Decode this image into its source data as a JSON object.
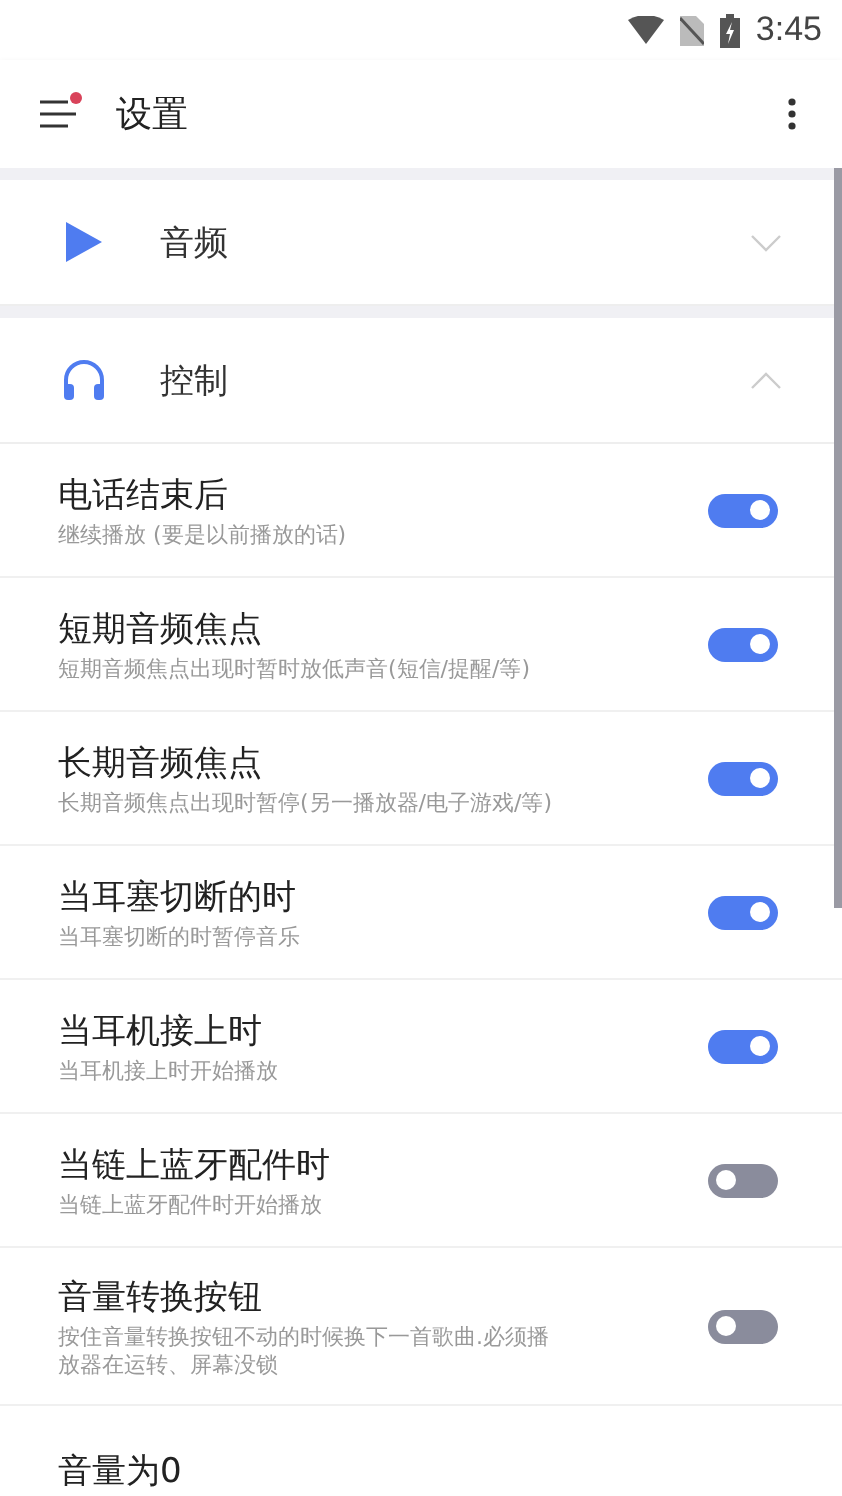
{
  "status_bar": {
    "time": "3:45"
  },
  "toolbar": {
    "title": "设置",
    "menu_badge": true
  },
  "sections": [
    {
      "kind": "play",
      "title": "音频",
      "expanded": false
    },
    {
      "kind": "headphones",
      "title": "控制",
      "expanded": true
    }
  ],
  "settings": [
    {
      "kind": "toggle",
      "title": "电话结束后",
      "subtitle": "继续播放 (要是以前播放的话)",
      "on": true
    },
    {
      "kind": "toggle",
      "title": "短期音频焦点",
      "subtitle": "短期音频焦点出现时暂时放低声音(短信/提醒/等)",
      "on": true
    },
    {
      "kind": "toggle",
      "title": "长期音频焦点",
      "subtitle": "长期音频焦点出现时暂停(另一播放器/电子游戏/等)",
      "on": true
    },
    {
      "kind": "toggle",
      "title": "当耳塞切断的时",
      "subtitle": "当耳塞切断的时暂停音乐",
      "on": true
    },
    {
      "kind": "toggle",
      "title": "当耳机接上时",
      "subtitle": "当耳机接上时开始播放",
      "on": true
    },
    {
      "kind": "toggle",
      "title": "当链上蓝牙配件时",
      "subtitle": "当链上蓝牙配件时开始播放",
      "on": false
    },
    {
      "kind": "toggle",
      "title": "音量转换按钮",
      "subtitle": "按住音量转换按钮不动的时候换下一首歌曲.必须播放器在运转、屏幕没锁",
      "on": false
    },
    {
      "kind": "plain",
      "title": "音量为0"
    }
  ]
}
